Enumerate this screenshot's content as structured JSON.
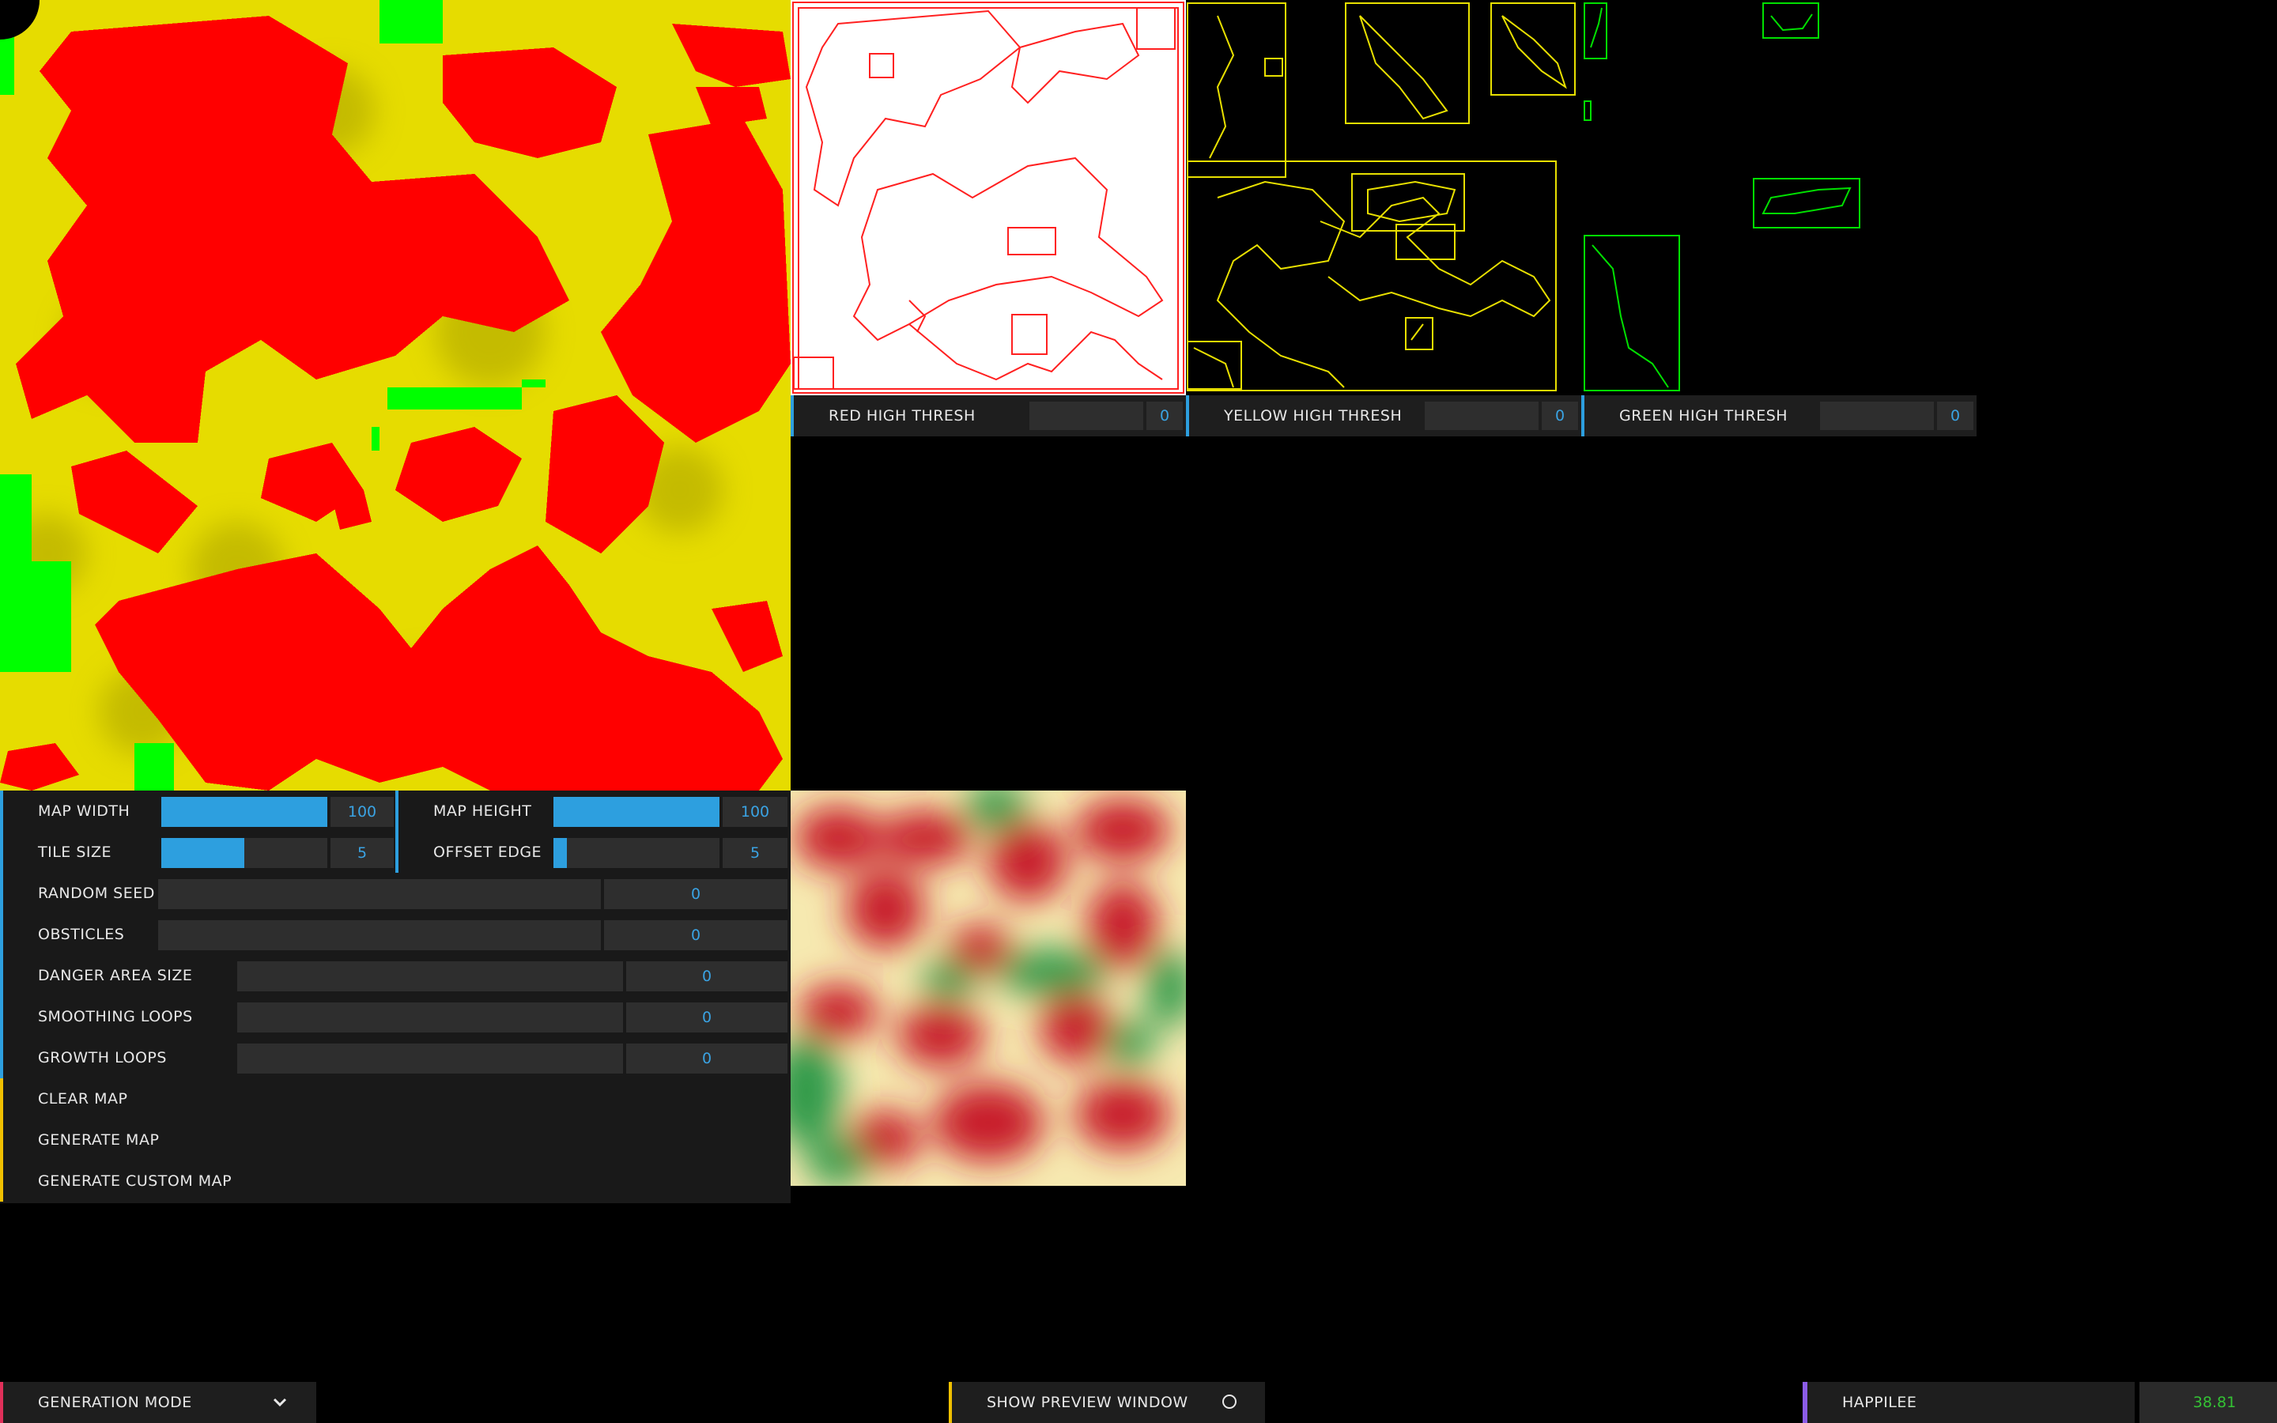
{
  "colors": {
    "accent": "#2d9fdf",
    "action_accent": "#f0c000",
    "danger_red": "#ff0000",
    "safe_green": "#00ff00",
    "ground_yellow": "#e8e000",
    "mode_accent": "#e0305a",
    "stat_accent": "#8c5ce8",
    "stat_value": "#34c234"
  },
  "thresholds": [
    {
      "label": "RED HIGH THRESH",
      "value": "0",
      "color": "#ff0000"
    },
    {
      "label": "YELLOW HIGH THRESH",
      "value": "0",
      "color": "#e8e000"
    },
    {
      "label": "GREEN HIGH THRESH",
      "value": "0",
      "color": "#00ff00"
    }
  ],
  "controls": {
    "map_width": {
      "label": "MAP WIDTH",
      "value": "100",
      "fill": 1.0
    },
    "map_height": {
      "label": "MAP HEIGHT",
      "value": "100",
      "fill": 1.0
    },
    "tile_size": {
      "label": "TILE SIZE",
      "value": "5",
      "fill": 0.5
    },
    "offset_edge": {
      "label": "OFFSET EDGE",
      "value": "5",
      "fill": 0.08
    },
    "random_seed": {
      "label": "RANDOM SEED",
      "value": "0"
    },
    "obstacles": {
      "label": "OBSTICLES",
      "value": "0"
    },
    "danger_area_size": {
      "label": "DANGER AREA SIZE",
      "value": "0"
    },
    "smoothing_loops": {
      "label": "SMOOTHING LOOPS",
      "value": "0"
    },
    "growth_loops": {
      "label": "GROWTH LOOPS",
      "value": "0"
    }
  },
  "actions": {
    "clear_map": "CLEAR MAP",
    "generate_map": "GENERATE MAP",
    "generate_custom_map": "GENERATE CUSTOM MAP"
  },
  "bottom_bar": {
    "generation_mode": "GENERATION MODE",
    "show_preview_window": "SHOW PREVIEW WINDOW",
    "stat_label": "HAPPILEE",
    "stat_value": "38.81"
  },
  "icons": {
    "dropdown": "chevron-down-icon",
    "preview_toggle": "radio-toggle-icon"
  }
}
